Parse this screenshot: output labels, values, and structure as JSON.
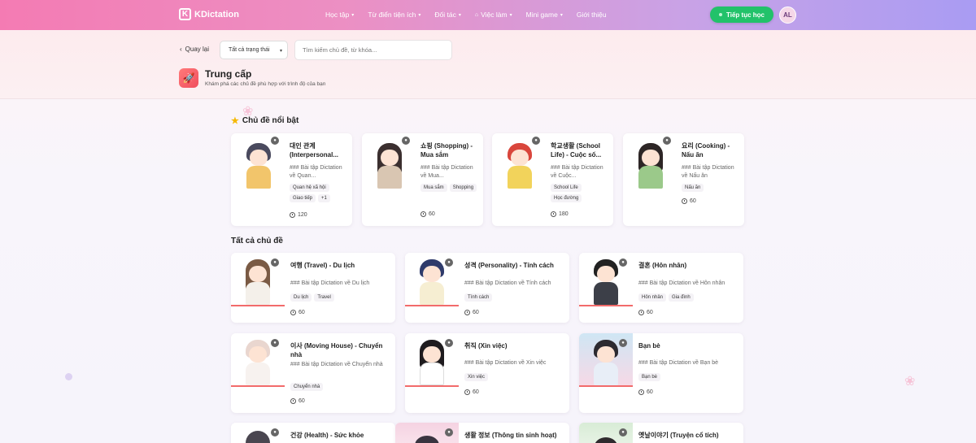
{
  "nav": {
    "logo_letter": "K",
    "logo_text": "KDictation",
    "menu": [
      {
        "label": "Học tập",
        "dropdown": true
      },
      {
        "label": "Từ điển tiện ích",
        "dropdown": true
      },
      {
        "label": "Đối tác",
        "dropdown": true
      },
      {
        "label": "Việc làm",
        "dropdown": true
      },
      {
        "label": "Mini game",
        "dropdown": true
      },
      {
        "label": "Giới thiệu",
        "dropdown": false
      }
    ],
    "cta_label": "Tiếp tục học",
    "avatar_initials": "AL"
  },
  "filters": {
    "back_label": "Quay lại",
    "status_select": "Tất cả trạng thái",
    "search_placeholder": "Tìm kiếm chủ đề, từ khóa..."
  },
  "level": {
    "title": "Trung cấp",
    "subtitle": "Khám phá các chủ đề phù hợp với trình độ của bạn"
  },
  "featured": {
    "title": "Chủ đề nổi bật",
    "cards": [
      {
        "title": "대인 관계 (Interpersonal...",
        "desc": "### Bài tập Dictation về Quan...",
        "tags": [
          "Quan hệ xã hội",
          "Giao tiếp",
          "+1"
        ],
        "count": "120"
      },
      {
        "title": "쇼핑 (Shopping) - Mua sắm",
        "desc": "### Bài tập Dictation về Mua...",
        "tags": [
          "Mua sắm",
          "Shopping"
        ],
        "count": "60"
      },
      {
        "title": "학교생활 (School Life) - Cuộc số...",
        "desc": "### Bài tập Dictation về Cuộc...",
        "tags": [
          "School Life",
          "Học đường"
        ],
        "count": "180"
      },
      {
        "title": "요리 (Cooking) - Nấu ăn",
        "desc": "### Bài tập Dictation về Nấu ăn",
        "tags": [
          "Nấu ăn"
        ],
        "count": "60"
      }
    ]
  },
  "all_topics": {
    "title": "Tất cả chủ đề",
    "cards": [
      {
        "title": "여행 (Travel) - Du lịch",
        "desc": "### Bài tập Dictation về Du lịch",
        "tags": [
          "Du lịch",
          "Travel"
        ],
        "count": "60"
      },
      {
        "title": "성격 (Personality) - Tính cách",
        "desc": "### Bài tập Dictation về Tính cách",
        "tags": [
          "Tính cách"
        ],
        "count": "60"
      },
      {
        "title": "결혼 (Hôn nhân)",
        "desc": "### Bài tập Dictation về Hôn nhân",
        "tags": [
          "Hôn nhân",
          "Gia đình"
        ],
        "count": "60"
      },
      {
        "title": "이사 (Moving House) - Chuyển nhà",
        "desc": "### Bài tập Dictation về Chuyển nhà",
        "tags": [
          "Chuyển nhà"
        ],
        "count": "60"
      },
      {
        "title": "취직 (Xin việc)",
        "desc": "### Bài tập Dictation về Xin việc",
        "tags": [
          "Xin việc"
        ],
        "count": "60"
      },
      {
        "title": "Bạn bè",
        "desc": "### Bài tập Dictation về Bạn bè",
        "tags": [
          "Bạn bè"
        ],
        "count": "60"
      },
      {
        "title": "건강 (Health) - Sức khỏe",
        "desc": "",
        "tags": [],
        "count": ""
      },
      {
        "title": "생활 정보 (Thông tin sinh hoạt)",
        "desc": "",
        "tags": [],
        "count": ""
      },
      {
        "title": "옛날이야기 (Truyện cổ tích)",
        "desc": "",
        "tags": [],
        "count": ""
      }
    ]
  },
  "colors": {
    "accent_green": "#22c26a",
    "level_icon": "#f04e5e",
    "thumb_underline": "#f26b6b"
  }
}
